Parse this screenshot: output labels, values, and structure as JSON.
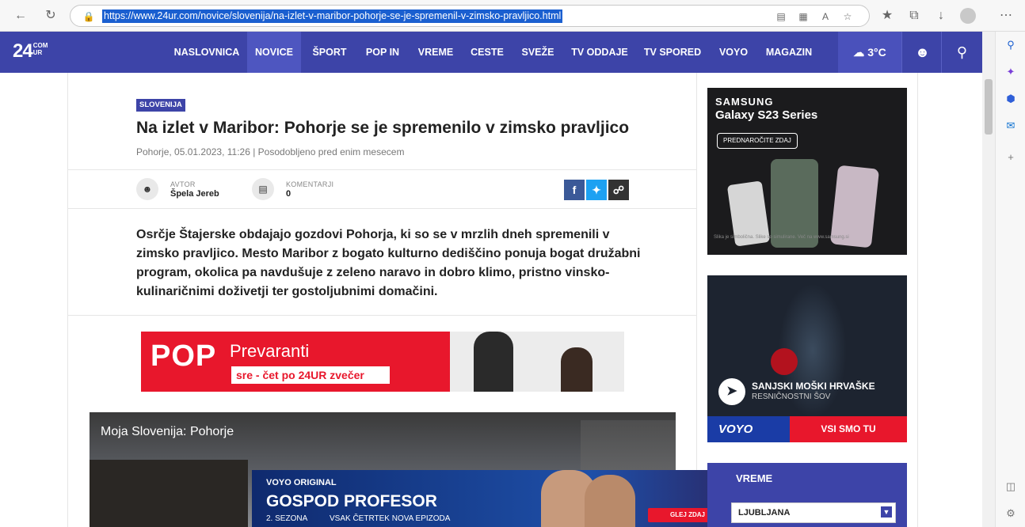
{
  "browser": {
    "url": "https://www.24ur.com/novice/slovenija/na-izlet-v-maribor-pohorje-se-je-spremenil-v-zimsko-pravljico.html"
  },
  "site": {
    "logo": "24",
    "logo_sup": "COM",
    "logo_sub": "UR",
    "nav": [
      "NASLOVNICA",
      "NOVICE",
      "ŠPORT",
      "POP IN",
      "VREME",
      "CESTE",
      "SVEŽE",
      "TV ODDAJE",
      "TV SPORED",
      "VOYO",
      "MAGAZIN"
    ],
    "active_nav": "NOVICE",
    "weather": "3°C",
    "brand_color": "#3d44a8"
  },
  "article": {
    "tag": "SLOVENIJA",
    "title": "Na izlet v Maribor: Pohorje se je spremenilo v zimsko pravljico",
    "dateline": "Pohorje, 05.01.2023, 11:26 | Posodobljeno pred enim mesecem",
    "author_label": "AVTOR",
    "author": "Špela Jereb",
    "comments_label": "KOMENTARJI",
    "comments": "0",
    "lead": "Osrčje Štajerske obdajajo gozdovi Pohorja, ki so se v mrzlih dneh spremenili v zimsko pravljico. Mesto Maribor z bogato kulturno dediščino ponuja bogat družabni program, okolica pa navdušuje z zeleno naravo in dobro klimo, pristno vinsko-kulinaričnimi doživetji ter gostoljubnimi domačini."
  },
  "pop_banner": {
    "logo": "POP",
    "show": "Prevaranti",
    "schedule": "sre - čet po 24UR zvečer"
  },
  "video": {
    "title": "Moja Slovenija: Pohorje"
  },
  "gospod_banner": {
    "brand": "VOYO ORIGINAL",
    "title": "GOSPOD PROFESOR",
    "season": "2. SEZONA",
    "schedule": "VSAK ČETRTEK NOVA EPIZODA",
    "cta": "GLEJ ZDAJ"
  },
  "samsung_ad": {
    "brand": "SAMSUNG",
    "model": "Galaxy S23 Series",
    "cta": "PREDNAROČITE ZDAJ",
    "fine_print": "Slika je simbolična. Slike so simulirane. Več na www.samsung.si"
  },
  "voyo_ad": {
    "title": "SANJSKI MOŠKI HRVAŠKE",
    "subtitle": "RESNIČNOSTNI ŠOV",
    "brand": "VOYO",
    "cta": "VSI SMO TU"
  },
  "vreme_widget": {
    "title": "VREME",
    "city": "LJUBLJANA"
  }
}
